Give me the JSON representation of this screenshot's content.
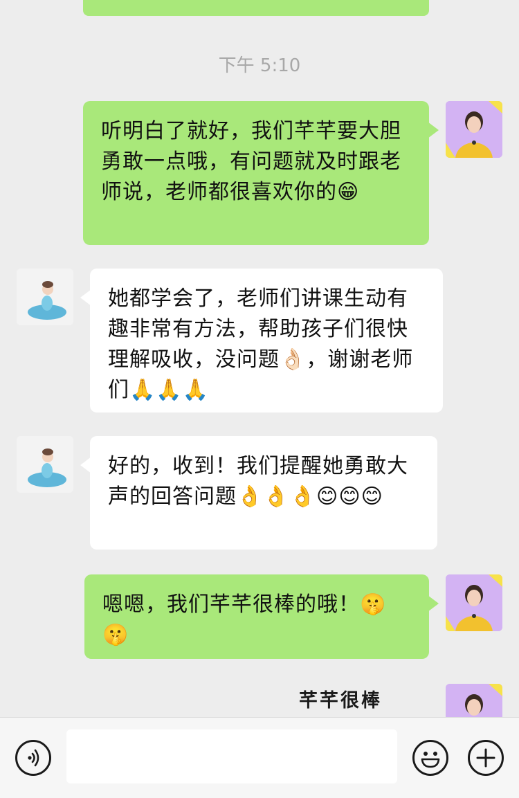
{
  "timestamp": "下午 5:10",
  "messages": [
    {
      "sender": "teacher",
      "text": "听明白了就好，我们芊芊要大胆勇敢一点哦，有问题就及时跟老师说，老师都很喜欢你的",
      "emojis": "😁"
    },
    {
      "sender": "parent",
      "text": "她都学会了，老师们讲课生动有趣非常有方法，帮助孩子们很快理解吸收，没问题👌🏻，谢谢老师们",
      "emojis": "🙏🙏🙏"
    },
    {
      "sender": "parent",
      "text": "好的，收到！我们提醒她勇敢大声的回答问题",
      "emojis": "👌👌👌😊😊😊"
    },
    {
      "sender": "teacher",
      "text": "嗯嗯，我们芊芊很棒的哦！",
      "emojis": "🤫🤫"
    }
  ],
  "sticker": {
    "text": "芊芊很棒"
  },
  "input_bar": {
    "voice_icon": "voice-icon",
    "emoji_icon": "emoji-icon",
    "plus_icon": "plus-icon"
  },
  "colors": {
    "sent_bubble": "#a9e87a",
    "received_bubble": "#ffffff",
    "background": "#ededed"
  }
}
